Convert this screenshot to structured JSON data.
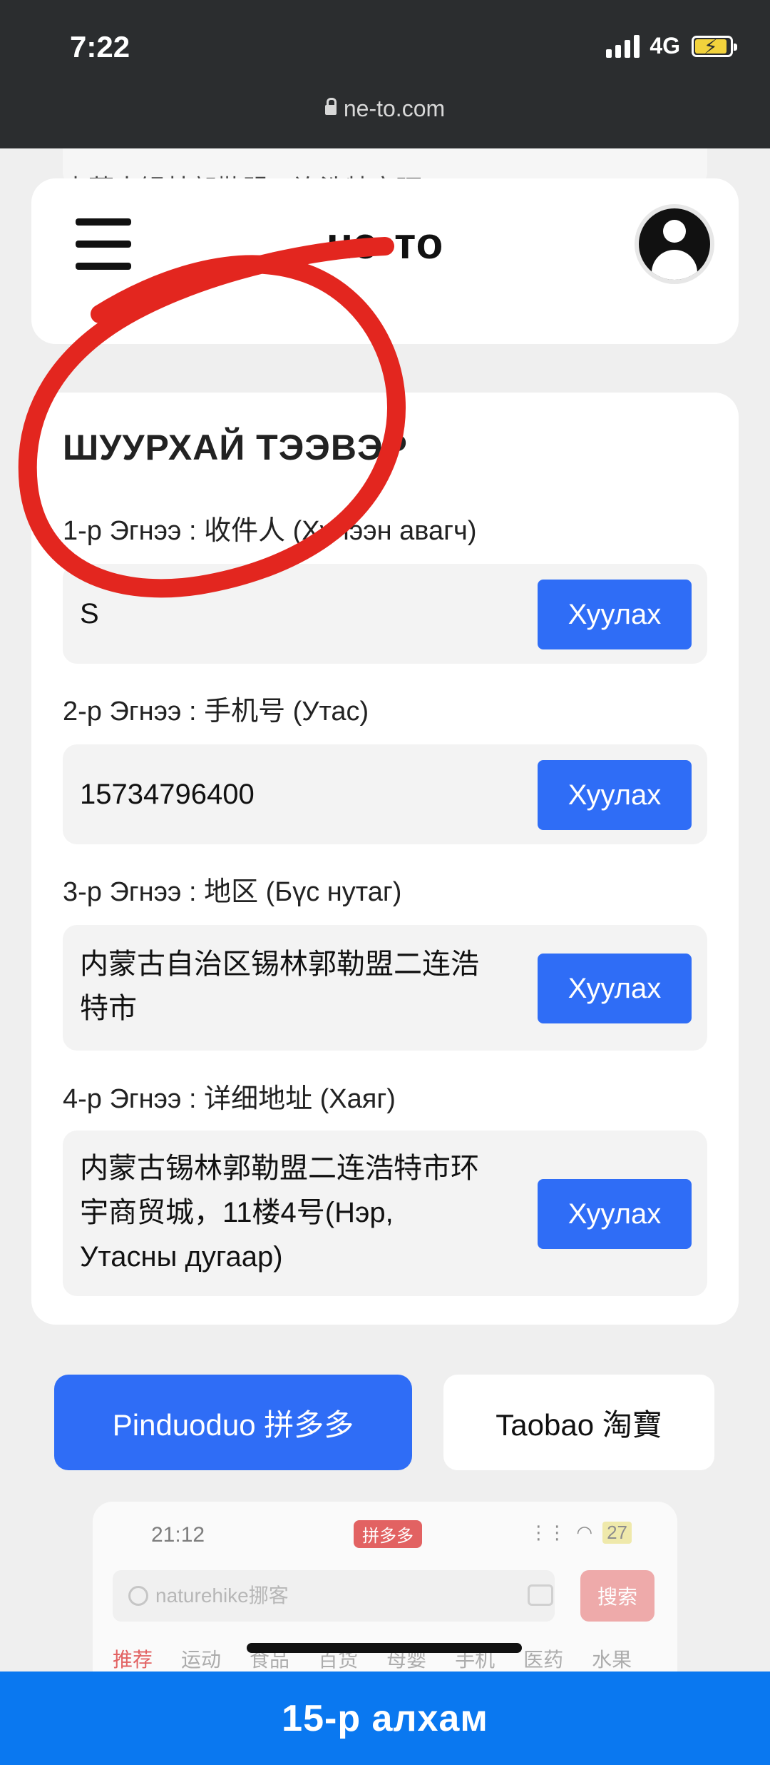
{
  "status_bar": {
    "time": "7:22",
    "network": "4G",
    "url": "ne-to.com"
  },
  "header": {
    "peek_text": "内蒙古锡林郭勒盟二连浩特市环",
    "brand": "нэ-то"
  },
  "section": {
    "title": "ШУУРХАЙ ТЭЭВЭР"
  },
  "fields": [
    {
      "label": "1-р Эгнээ : 收件人 (Хүлээн авагч)",
      "value": "S",
      "button": "Хуулах"
    },
    {
      "label": "2-р Эгнээ : 手机号 (Утас)",
      "value": "15734796400",
      "button": "Хуулах"
    },
    {
      "label": "3-р Эгнээ : 地区 (Бүс нутаг)",
      "value_lines": [
        "内蒙古自治区锡林郭勒盟二连浩",
        "特市"
      ],
      "button": "Хуулах"
    },
    {
      "label": "4-р Эгнээ : 详细地址 (Хаяг)",
      "value_lines": [
        "内蒙古锡林郭勒盟二连浩特市环",
        "宇商贸城，11楼4号(Нэр,",
        "Утасны дугаар)"
      ],
      "button": "Хуулах"
    }
  ],
  "platforms": {
    "pinduoduo": "Pinduoduo 拼多多",
    "taobao": "Taobao 淘寶"
  },
  "preview": {
    "time": "21:12",
    "badge": "拼多多",
    "battery": "27",
    "search_placeholder": "naturehike挪客",
    "search_button": "搜索",
    "tabs": [
      "推荐",
      "运动",
      "食品",
      "百货",
      "母婴",
      "手机",
      "医药",
      "水果"
    ]
  },
  "footer": {
    "step": "15-р алхам"
  },
  "colors": {
    "accent": "#2f6df6",
    "footer": "#0a78f0",
    "annotation": "#e3261f"
  }
}
